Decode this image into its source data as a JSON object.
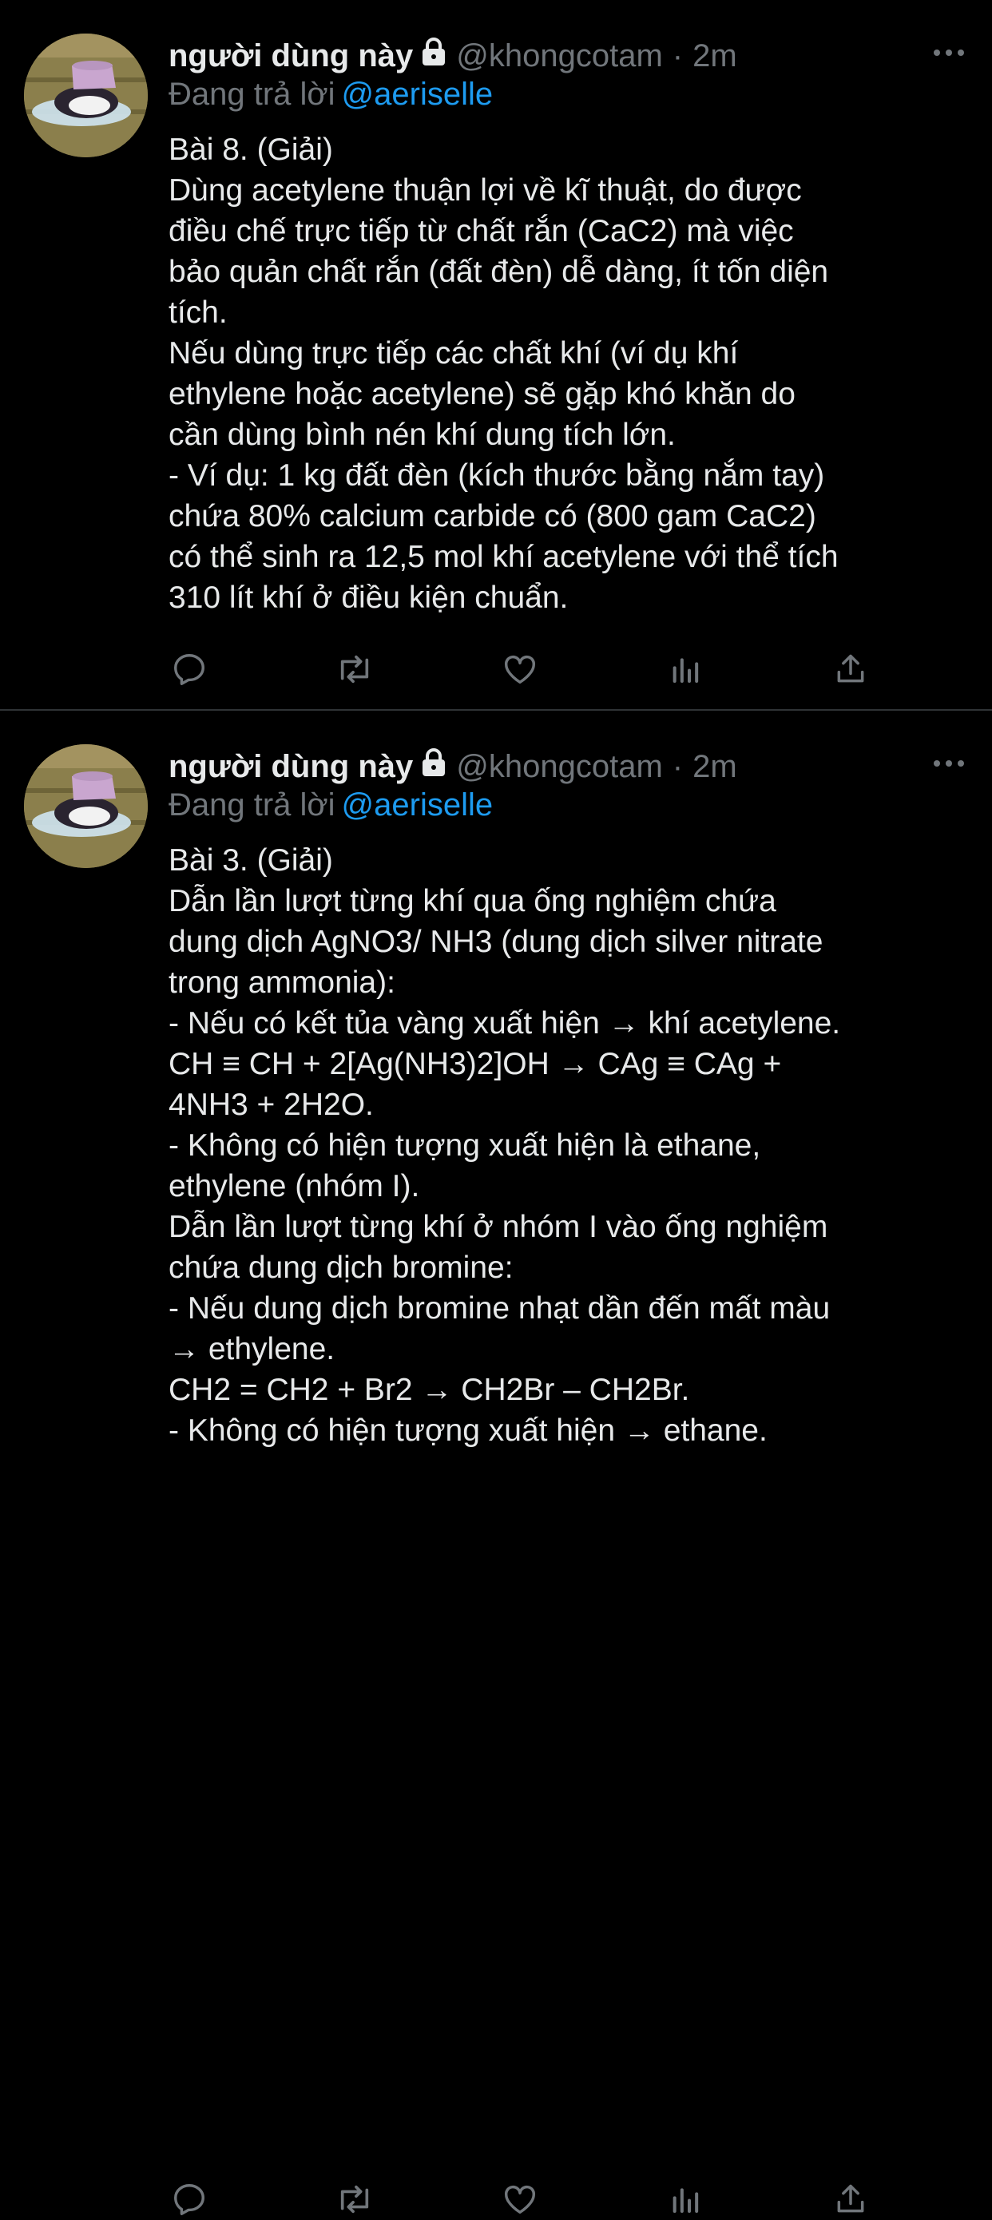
{
  "tweets": [
    {
      "author": "người dùng này",
      "handle": "@khongcotam",
      "separator": "·",
      "time": "2m",
      "reply_prefix": "Đang trả lời",
      "reply_to": "@aeriselle",
      "lines": [
        "Bài 8. (Giải)",
        "Dùng acetylene thuận lợi về kĩ thuật, do được",
        "điều chế trực tiếp từ chất rắn (CaC2) mà việc",
        "bảo quản chất rắn (đất đèn) dễ dàng, ít tốn diện",
        "tích.",
        "Nếu dùng trực tiếp các chất khí (ví dụ khí",
        "ethylene hoặc acetylene) sẽ gặp khó khăn do",
        "cần dùng bình nén khí dung tích lớn.",
        "- Ví dụ: 1 kg đất đèn (kích thước bằng nắm tay)",
        "chứa 80% calcium carbide có (800 gam CaC2)",
        "có thể sinh ra 12,5 mol khí acetylene với thể tích",
        "310 lít khí ở điều kiện chuẩn."
      ]
    },
    {
      "author": "người dùng này",
      "handle": "@khongcotam",
      "separator": "·",
      "time": "2m",
      "reply_prefix": "Đang trả lời",
      "reply_to": "@aeriselle",
      "lines": [
        "Bài 3. (Giải)",
        "Dẫn lần lượt từng khí qua ống nghiệm chứa",
        "dung dịch AgNO3/ NH3 (dung dịch silver nitrate",
        "trong ammonia):",
        "- Nếu có kết tủa vàng xuất hiện → khí acetylene.",
        "CH ≡ CH + 2[Ag(NH3)2]OH → CAg ≡ CAg +",
        "4NH3 + 2H2O.",
        "- Không có hiện tượng xuất hiện là ethane,",
        "ethylene (nhóm I).",
        "Dẫn lần lượt từng khí ở nhóm I vào ống nghiệm",
        "chứa dung dịch bromine:",
        "- Nếu dung dịch bromine nhạt dần đến mất màu",
        "→ ethylene.",
        "CH2 = CH2 + Br2 → CH2Br – CH2Br.",
        "- Không có hiện tượng xuất hiện → ethane."
      ]
    }
  ],
  "icons": {
    "more": "more-horizontal-icon",
    "lock": "lock-icon",
    "actions": [
      "reply-icon",
      "retweet-icon",
      "like-icon",
      "analytics-icon",
      "share-icon"
    ]
  },
  "colors": {
    "background": "#000000",
    "text": "#e7e9ea",
    "secondary": "#71767b",
    "link": "#1d9bf0",
    "divider": "#2f3336"
  }
}
